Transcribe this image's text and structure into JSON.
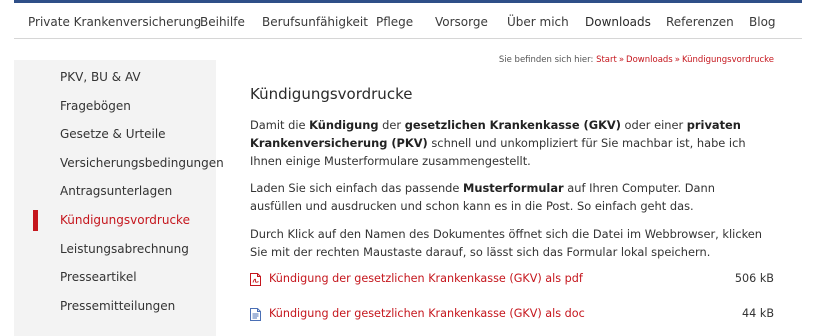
{
  "nav": {
    "items": [
      {
        "label": "Private Krankenversicherung"
      },
      {
        "label": "Beihilfe"
      },
      {
        "label": "Berufsunfähigkeit"
      },
      {
        "label": "Pflege"
      },
      {
        "label": "Vorsorge"
      },
      {
        "label": "Über mich"
      },
      {
        "label": "Downloads"
      },
      {
        "label": "Referenzen"
      },
      {
        "label": "Blog"
      }
    ]
  },
  "sidebar": {
    "items": [
      {
        "label": "PKV, BU & AV"
      },
      {
        "label": "Fragebögen"
      },
      {
        "label": "Gesetze & Urteile"
      },
      {
        "label": "Versicherungsbedingungen"
      },
      {
        "label": "Antragsunterlagen"
      },
      {
        "label": "Kündigungsvordrucke"
      },
      {
        "label": "Leistungsabrechnung"
      },
      {
        "label": "Presseartikel"
      },
      {
        "label": "Pressemitteilungen"
      }
    ],
    "active_index": 5
  },
  "breadcrumb": {
    "prefix": "Sie befinden sich hier:",
    "items": [
      "Start",
      "Downloads",
      "Kündigungsvordrucke"
    ],
    "separator": "»"
  },
  "content": {
    "title": "Kündigungsvordrucke",
    "p1": {
      "t1": "Damit die ",
      "b1": "Kündigung",
      "t2": " der ",
      "b2": "gesetzlichen Krankenkasse (GKV)",
      "t3": " oder einer ",
      "b3": "privaten Krankenversicherung (PKV)",
      "t4": " schnell und unkompliziert für Sie machbar ist, habe ich Ihnen einige Musterformulare zusammengestellt."
    },
    "p2": {
      "t1": "Laden Sie sich einfach das passende ",
      "b1": "Musterformular",
      "t2": " auf Ihren Computer. Dann ausfüllen und ausdrucken und schon kann es in die Post. So einfach geht das."
    },
    "p3": "Durch Klick auf den Namen des Dokumentes öffnet sich die Datei im Webbrowser, klicken Sie mit der rechten Maustaste darauf, so lässt sich das Formular lokal speichern.",
    "downloads": [
      {
        "label": "Kündigung der gesetzlichen Krankenkasse (GKV) als pdf",
        "size": "506 kB",
        "icon": "pdf-file-icon"
      },
      {
        "label": "Kündigung der gesetzlichen Krankenkasse (GKV) als doc",
        "size": "44 kB",
        "icon": "doc-file-icon"
      }
    ]
  },
  "colors": {
    "accent": "#c5161d",
    "topline": "#2f4f88",
    "sidebar_bg": "#f3f3f3"
  }
}
